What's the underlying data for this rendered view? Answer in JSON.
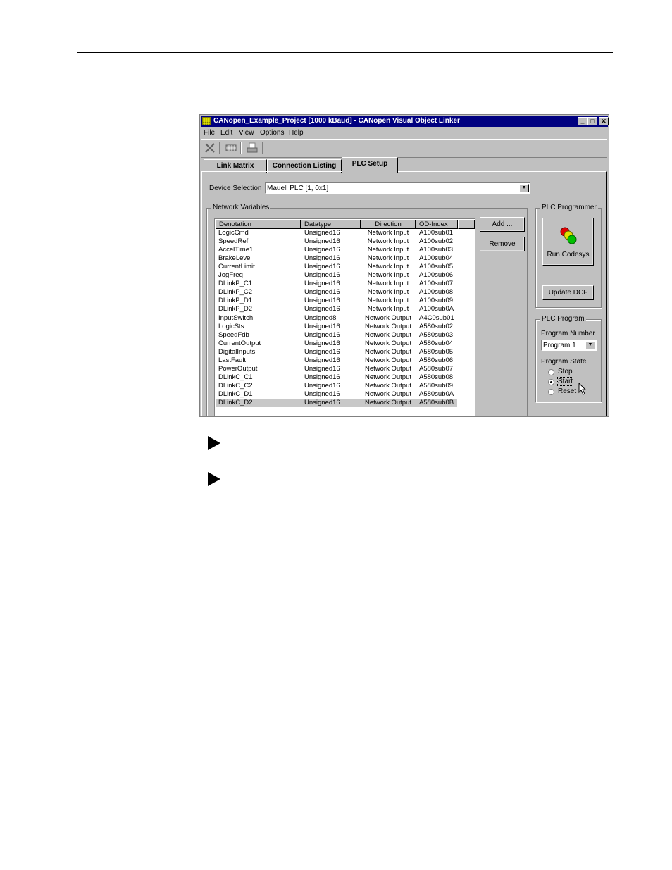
{
  "window": {
    "title": "CANopen_Example_Project  [1000 kBaud] - CANopen Visual Object Linker",
    "minimize_glyph": "_",
    "maximize_glyph": "□",
    "close_glyph": "✕"
  },
  "menu": [
    "File",
    "Edit",
    "View",
    "Options",
    "Help"
  ],
  "toolbar_icons": [
    "network-scan-icon",
    "grid-icon",
    "print-icon"
  ],
  "tabs": [
    {
      "label": "Link Matrix",
      "active": false
    },
    {
      "label": "Connection Listing",
      "active": false
    },
    {
      "label": "PLC Setup",
      "active": true
    }
  ],
  "device_selection": {
    "label": "Device Selection",
    "value": "Mauell PLC  [1, 0x1]",
    "arrow": "▼"
  },
  "network_variables": {
    "group_label": "Network Variables",
    "columns": [
      "Denotation",
      "Datatype",
      "Direction",
      "OD-Index"
    ],
    "rows": [
      [
        "LogicCmd",
        "Unsigned16",
        "Network Input",
        "A100sub01"
      ],
      [
        "SpeedRef",
        "Unsigned16",
        "Network Input",
        "A100sub02"
      ],
      [
        "AccelTime1",
        "Unsigned16",
        "Network Input",
        "A100sub03"
      ],
      [
        "BrakeLevel",
        "Unsigned16",
        "Network Input",
        "A100sub04"
      ],
      [
        "CurrentLimit",
        "Unsigned16",
        "Network Input",
        "A100sub05"
      ],
      [
        "JogFreq",
        "Unsigned16",
        "Network Input",
        "A100sub06"
      ],
      [
        "DLinkP_C1",
        "Unsigned16",
        "Network Input",
        "A100sub07"
      ],
      [
        "DLinkP_C2",
        "Unsigned16",
        "Network Input",
        "A100sub08"
      ],
      [
        "DLinkP_D1",
        "Unsigned16",
        "Network Input",
        "A100sub09"
      ],
      [
        "DLinkP_D2",
        "Unsigned16",
        "Network Input",
        "A100sub0A"
      ],
      [
        "InputSwitch",
        "Unsigned8",
        "Network Output",
        "A4C0sub01"
      ],
      [
        "LogicSts",
        "Unsigned16",
        "Network Output",
        "A580sub02"
      ],
      [
        "SpeedFdb",
        "Unsigned16",
        "Network Output",
        "A580sub03"
      ],
      [
        "CurrentOutput",
        "Unsigned16",
        "Network Output",
        "A580sub04"
      ],
      [
        "DigitalInputs",
        "Unsigned16",
        "Network Output",
        "A580sub05"
      ],
      [
        "LastFault",
        "Unsigned16",
        "Network Output",
        "A580sub06"
      ],
      [
        "PowerOutput",
        "Unsigned16",
        "Network Output",
        "A580sub07"
      ],
      [
        "DLinkC_C1",
        "Unsigned16",
        "Network Output",
        "A580sub08"
      ],
      [
        "DLinkC_C2",
        "Unsigned16",
        "Network Output",
        "A580sub09"
      ],
      [
        "DLinkC_D1",
        "Unsigned16",
        "Network Output",
        "A580sub0A"
      ],
      [
        "DLinkC_D2",
        "Unsigned16",
        "Network Output",
        "A580sub0B"
      ]
    ],
    "selected_row": 20,
    "add_label": "Add ...",
    "remove_label": "Remove"
  },
  "plc_programmer": {
    "group_label": "PLC Programmer",
    "run_label": "Run Codesys",
    "update_label": "Update DCF"
  },
  "plc_program": {
    "group_label": "PLC Program",
    "number_label": "Program Number",
    "number_value": "Program 1",
    "number_arrow": "▼",
    "state_label": "Program State",
    "states": [
      "Stop",
      "Start",
      "Reset"
    ],
    "selected_state": "Start"
  }
}
